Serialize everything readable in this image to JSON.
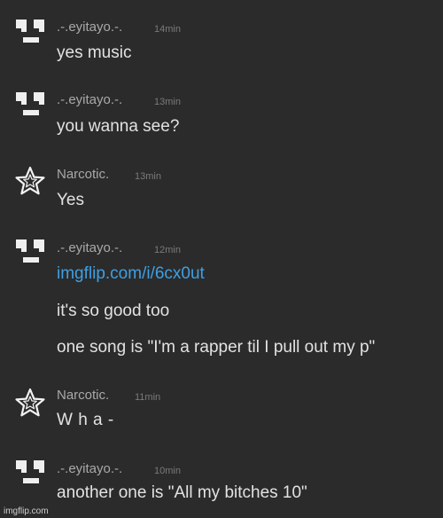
{
  "messages": [
    {
      "author": ".-.eyitayo.-.",
      "avatar_icon": "face-icon",
      "time": "14min",
      "lines": [
        "yes music"
      ]
    },
    {
      "author": ".-.eyitayo.-.",
      "avatar_icon": "face-icon",
      "time": "13min",
      "lines": [
        "you wanna see?"
      ]
    },
    {
      "author": "Narcotic.",
      "avatar_icon": "star-icon",
      "time": "13min",
      "lines": [
        "Yes"
      ]
    },
    {
      "author": ".-.eyitayo.-.",
      "avatar_icon": "face-icon",
      "time": "12min",
      "lines": [
        "imgflip.com/i/6cx0ut",
        "it's so good too",
        "one song is \"I'm a rapper til I pull out my p\""
      ]
    },
    {
      "author": "Narcotic.",
      "avatar_icon": "star-icon",
      "time": "11min",
      "lines": [
        "W h a -"
      ]
    },
    {
      "author": ".-.eyitayo.-.",
      "avatar_icon": "face-icon",
      "time": "10min",
      "lines": [
        "another one is \"All my bitches 10\""
      ]
    }
  ],
  "watermark": "imgflip.com",
  "colors": {
    "background": "#2b2b2b",
    "author": "#a9a9a9",
    "timestamp": "#7a7a7a",
    "text": "#e2e2e2",
    "link": "#3ea0e4"
  }
}
